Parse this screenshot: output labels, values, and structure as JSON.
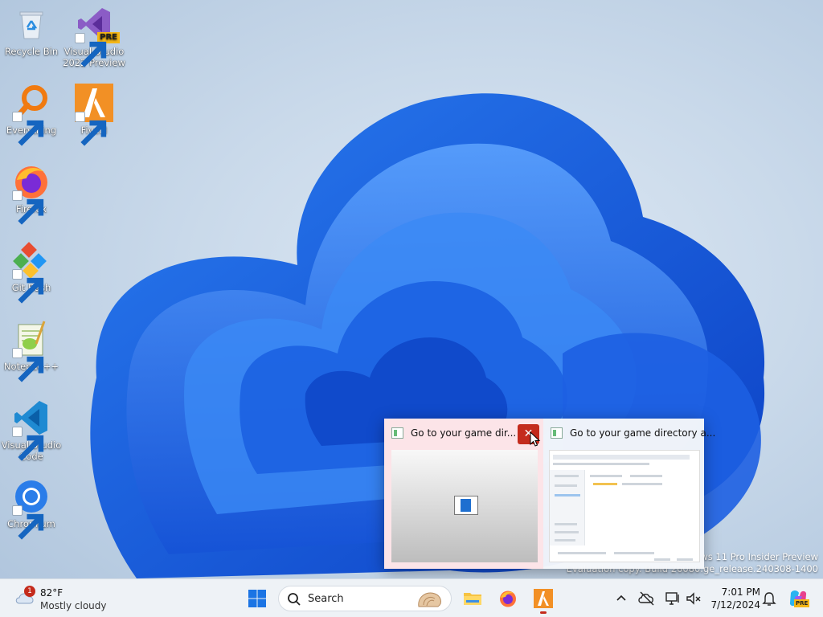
{
  "desktop": {
    "icons": [
      {
        "label": "Recycle Bin",
        "icon": "recycle-bin-icon"
      },
      {
        "label": "Visual Studio 2022 Preview",
        "icon": "visual-studio-icon"
      },
      {
        "label": "Everything",
        "icon": "everything-icon"
      },
      {
        "label": "FiveM",
        "icon": "fivem-icon"
      },
      {
        "label": "Firefox",
        "icon": "firefox-icon"
      },
      {
        "label": "Git Bash",
        "icon": "git-bash-icon"
      },
      {
        "label": "Notepad++",
        "icon": "notepad-plus-plus-icon"
      },
      {
        "label": "Visual Studio Code",
        "icon": "vscode-icon"
      },
      {
        "label": "Chromium",
        "icon": "chromium-icon"
      }
    ],
    "vs_badge": "PRE",
    "watermark_line1": "ndows 11 Pro Insider Preview",
    "watermark_line2": "Evaluation copy. Build 26080.ge_release.240308-1400"
  },
  "preview": {
    "window1_title": "Go to your game dir...",
    "window2_title": "Go to your game directory a...",
    "close_glyph": "✕"
  },
  "taskbar": {
    "weather": {
      "badge": "1",
      "temp": "82°F",
      "condition": "Mostly cloudy"
    },
    "search_placeholder": "Search",
    "time": "7:01 PM",
    "date": "7/12/2024",
    "copilot_badge": "PRE"
  },
  "colors": {
    "accent": "#1e6fd0",
    "close_red": "#c42b1c",
    "fivem_orange": "#f29025"
  }
}
